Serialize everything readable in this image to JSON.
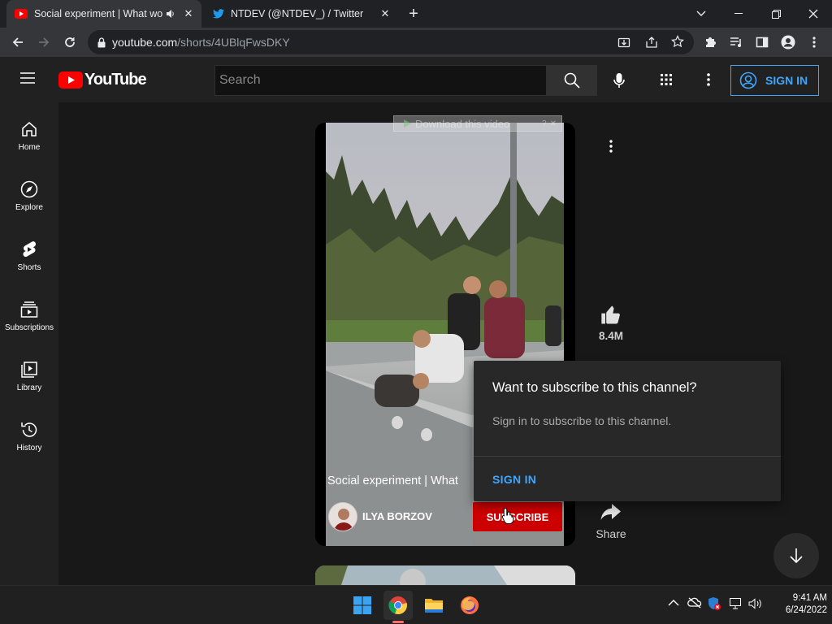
{
  "browser": {
    "tabs": [
      {
        "title": "Social experiment | What wo",
        "icon": "youtube-icon",
        "active": true
      },
      {
        "title": "NTDEV (@NTDEV_) / Twitter",
        "icon": "twitter-icon",
        "active": false
      }
    ],
    "url_host": "youtube.com",
    "url_path": "/shorts/4UBlqFwsDKY"
  },
  "masthead": {
    "logo_text": "YouTube",
    "search_placeholder": "Search",
    "sign_in_label": "SIGN IN"
  },
  "sidebar": {
    "items": [
      {
        "label": "Home",
        "icon": "home-icon"
      },
      {
        "label": "Explore",
        "icon": "compass-icon"
      },
      {
        "label": "Shorts",
        "icon": "shorts-icon"
      },
      {
        "label": "Subscriptions",
        "icon": "subscriptions-icon"
      },
      {
        "label": "Library",
        "icon": "library-icon"
      },
      {
        "label": "History",
        "icon": "history-icon"
      }
    ]
  },
  "short": {
    "title": "Social experiment | What",
    "channel": "ILYA BORZOV",
    "subscribe_label": "SUBSCRIBE",
    "download_label": "Download this video",
    "likes": "8.4M",
    "share_label": "Share"
  },
  "popup": {
    "title": "Want to subscribe to this channel?",
    "body": "Sign in to subscribe to this channel.",
    "action": "SIGN IN"
  },
  "taskbar": {
    "time": "9:41 AM",
    "date": "6/24/2022"
  },
  "colors": {
    "accent_blue": "#3ea6ff",
    "youtube_red": "#ff0000",
    "subscribe_red": "#cc0000"
  }
}
